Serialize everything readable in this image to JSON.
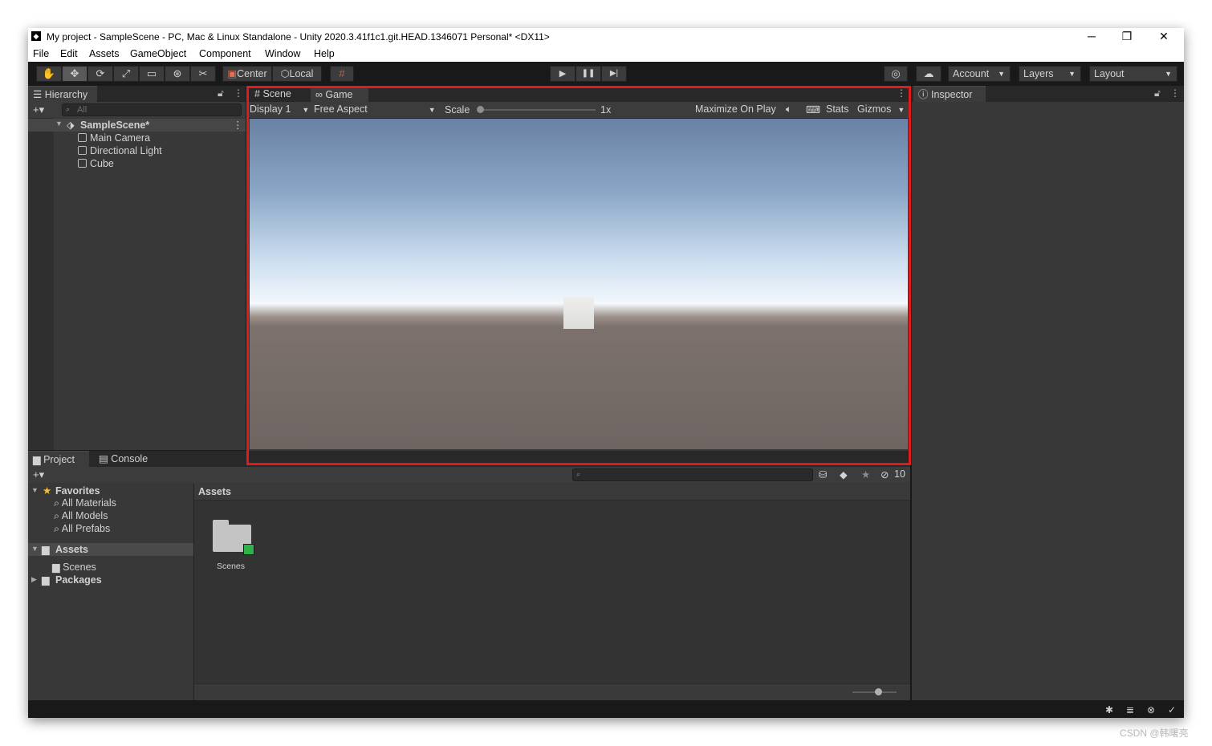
{
  "window": {
    "title": "My project - SampleScene - PC, Mac & Linux Standalone - Unity 2020.3.41f1c1.git.HEAD.1346071 Personal* <DX11>",
    "app_icon": "unity-icon",
    "minimize": "─",
    "restore": "❐",
    "close": "✕"
  },
  "menu": [
    "File",
    "Edit",
    "Assets",
    "GameObject",
    "Component",
    "Window",
    "Help"
  ],
  "toolbar": {
    "tools": [
      "hand-tool-icon",
      "move-tool-icon",
      "rotate-tool-icon",
      "scale-tool-icon",
      "rect-tool-icon",
      "transform-tool-icon",
      "custom-tool-icon"
    ],
    "tool_glyphs": [
      "✋",
      "✥",
      "⟳",
      "⤢",
      "▭",
      "⊛",
      "✂"
    ],
    "pivot": "Center",
    "space": "Local",
    "grid_glyph": "#",
    "play": "▶",
    "pause": "❚❚",
    "step": "▶|",
    "collab_glyph": "◎",
    "cloud_glyph": "☁",
    "account": "Account",
    "layers": "Layers",
    "layout": "Layout"
  },
  "hierarchy": {
    "tab": "Hierarchy",
    "add": "+▾",
    "search_placeholder": "All",
    "scene": "SampleScene*",
    "items": [
      "Main Camera",
      "Directional Light",
      "Cube"
    ]
  },
  "scene_tabs": {
    "scene": "Scene",
    "game": "Game"
  },
  "game_toolbar": {
    "display": "Display 1",
    "aspect": "Free Aspect",
    "scale_label": "Scale",
    "scale_value": "1x",
    "maximize": "Maximize On Play",
    "stats": "Stats",
    "gizmos": "Gizmos"
  },
  "inspector": {
    "tab": "Inspector"
  },
  "project": {
    "tab_project": "Project",
    "tab_console": "Console",
    "add": "+▾",
    "favorites": "Favorites",
    "favorite_items": [
      "All Materials",
      "All Models",
      "All Prefabs"
    ],
    "assets": "Assets",
    "asset_children": [
      "Scenes"
    ],
    "packages": "Packages",
    "breadcrumb": "Assets",
    "folder_item": "Scenes",
    "hidden_count": "10"
  },
  "watermark": "CSDN @韩曙亮",
  "colors": {
    "accent_red": "#e11a1a",
    "panel": "#383838",
    "toolbar": "#191919"
  }
}
